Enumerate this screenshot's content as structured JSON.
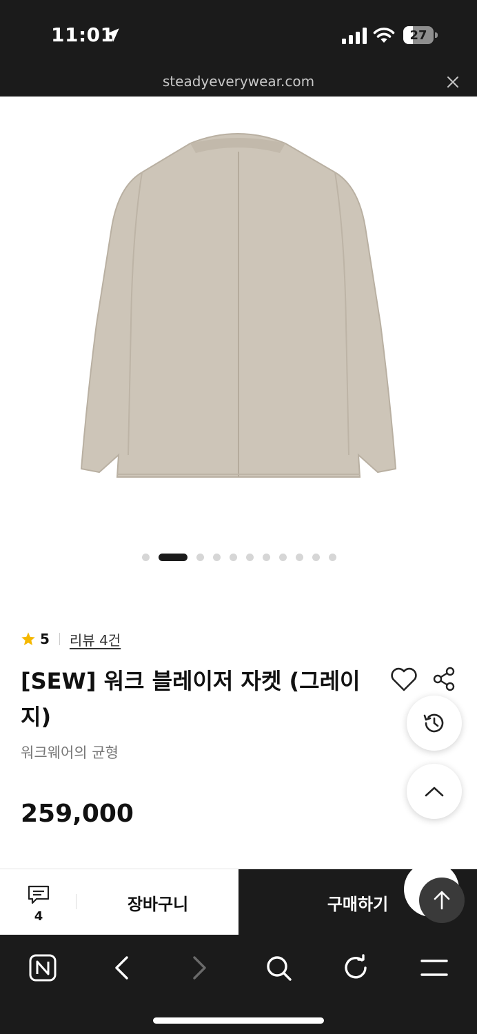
{
  "status_bar": {
    "time": "11:01",
    "battery": "27",
    "battery_level": 0.27
  },
  "url_bar": {
    "url": "steadyeverywear.com",
    "close_icon": "close-icon"
  },
  "product_image": {
    "icon": "jacket-image",
    "carousel": {
      "total": 11,
      "active_index": 1
    }
  },
  "rating": {
    "value": "5",
    "reviews": "리뷰 4건",
    "star_color": "#f5b800"
  },
  "product": {
    "title": "[SEW] 워크 블레이저 자켓 (그레이지)",
    "subtitle": "워크웨어의 균형",
    "price": "259,000"
  },
  "actions": {
    "heart_icon": "heart-icon",
    "share_icon": "share-icon",
    "history_icon": "history-icon",
    "up_icon": "chevron-up-icon"
  },
  "bottom_bar": {
    "chat_count": "4",
    "cart_label": "장바구니",
    "buy_label": "구매하기"
  },
  "browser_toolbar": {
    "icons": [
      "naver-n-icon",
      "back-icon",
      "forward-icon",
      "search-icon",
      "refresh-icon",
      "menu-icon"
    ]
  },
  "colors": {
    "dark": "#1b1b1b",
    "jacket": "#cdc5b8"
  }
}
